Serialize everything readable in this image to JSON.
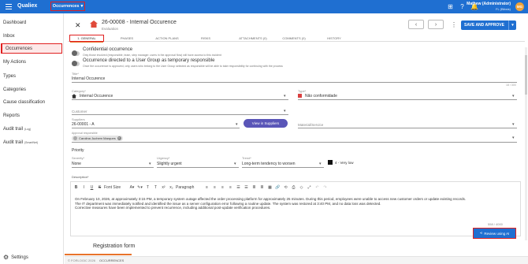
{
  "topbar": {
    "brand": "Qualiex",
    "module": "Occurrences",
    "user_name": "Mathew (Administrator)",
    "user_sub": "FL (Bibsis)",
    "avatar_initials": "MG",
    "icons": [
      "grid-icon",
      "help-icon",
      "bell-icon"
    ]
  },
  "sidebar": {
    "items": [
      {
        "label": "Dashboard",
        "badge": ""
      },
      {
        "label": "Inbox",
        "badge": ""
      },
      {
        "label": "Occurrences",
        "badge": ""
      },
      {
        "label": "My Actions",
        "badge": ""
      },
      {
        "label": "Types",
        "badge": ""
      },
      {
        "label": "Categories",
        "badge": ""
      },
      {
        "label": "Cause classification",
        "badge": ""
      },
      {
        "label": "Reports",
        "badge": ""
      },
      {
        "label": "Audit trail",
        "badge": "(Log)"
      },
      {
        "label": "Audit trail",
        "badge": "(SmartNet)"
      }
    ],
    "settings": "Settings"
  },
  "header": {
    "code_title": "26-00008 - Internal Occurence",
    "status": "Evaluation",
    "save_label": "SAVE AND APPROVE"
  },
  "tabs": [
    "1. GENERAL",
    "PHASES",
    "ACTION PLANS",
    "RISKS",
    "ATTACHMENTS (0)",
    "COMMENTS (0)",
    "HISTORY"
  ],
  "toggles": [
    {
      "title": "Confidential occurrence",
      "desc": "Only those involved (responsible, team, step manager, users in the approval flow) will have access to this incident"
    },
    {
      "title": "Occurrence directed to a User Group as temporary responsible",
      "desc": "Once the occurrence is approved, only users who belong to the User Group selected as responsible will be able to take responsibility for continuing with the process"
    }
  ],
  "form": {
    "title_label": "Title*",
    "title_value": "Internal Occurence",
    "title_counter": "18 / 300",
    "category_label": "Category*",
    "category_value": "Internal Occurence",
    "type_label": "Type*",
    "type_value": "Não conformidade",
    "customer_label": "Customer",
    "suppliers_label": "Suppliers",
    "suppliers_value": "26-00001 - A",
    "view_suppliers": "View in Suppliers",
    "material_label": "Material/Service",
    "approval_label": "Approval responsible",
    "approval_value": "Carolina Juchem Marques",
    "priority_head": "Priority",
    "severity_label": "Severity*",
    "severity_value": "None",
    "urgency_label": "Urgency*",
    "urgency_value": "Slightly urgent",
    "trend_label": "Trend*",
    "trend_value": "Long-term tendency to worsen",
    "priority_value": "4 - Very low",
    "description_label": "Description*"
  },
  "editor": {
    "tools": [
      "B",
      "I",
      "U",
      "S",
      "Font Size",
      "A▾",
      "✎▾",
      "T",
      "T",
      "x²",
      "x₂",
      "Paragraph",
      "≡",
      "≡",
      "≡",
      "≡",
      "☰",
      "☰",
      "≣",
      "≣",
      "▦",
      "🔗",
      "⟲",
      "⎙",
      "◇",
      "⤢",
      "↶",
      "↷"
    ],
    "body_lines": [
      "On February 10, 2026, at approximately 3:15 PM, a temporary system outage affected the order processing platform for approximately 25 minutes. During this period, employees were unable to access new customer orders or update existing records.",
      "The IT department was immediately notified and identified the issue as a server configuration error following a routine update. The system was restored at 3:40 PM, and no data loss was detected.",
      "Corrective measures have been implemented to prevent recurrence, including additional post-update verification procedures."
    ],
    "counter": "558 / 4000",
    "ai_button": "Review using AI"
  },
  "registration_title": "Registration form",
  "footer": {
    "copyright": "© FORLOGIC 2026",
    "module": "OCCURRENCES"
  }
}
